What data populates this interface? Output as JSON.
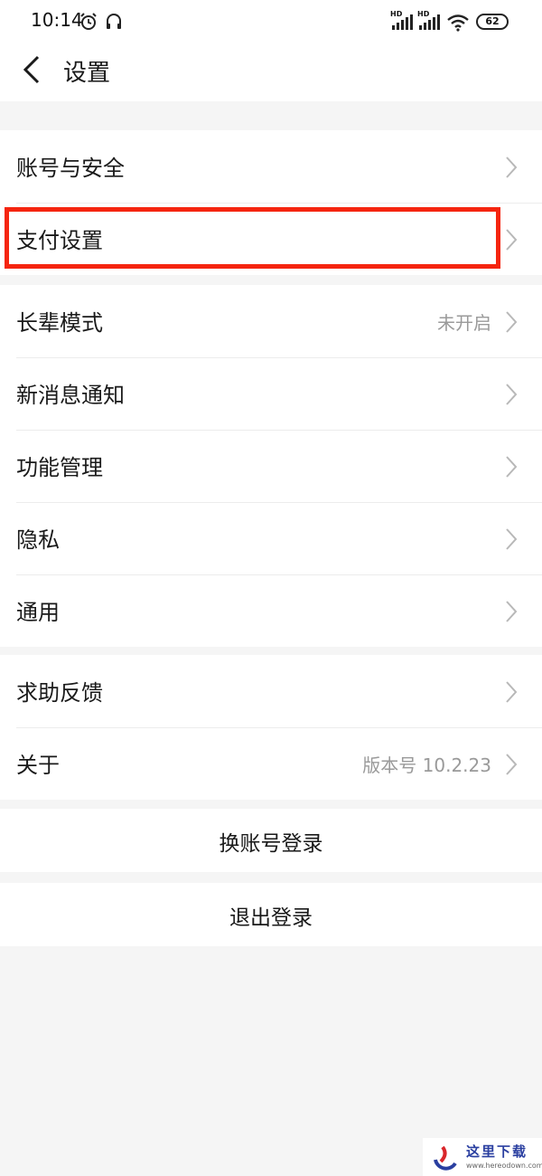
{
  "status_bar": {
    "time": "10:14",
    "signal_1_label": "HD",
    "signal_2_label": "HD",
    "battery": "62"
  },
  "header": {
    "title": "设置",
    "back_icon": "chevron-left-icon"
  },
  "groups": [
    {
      "items": [
        {
          "label": "账号与安全",
          "value": ""
        },
        {
          "label": "支付设置",
          "value": ""
        }
      ]
    },
    {
      "items": [
        {
          "label": "长辈模式",
          "value": "未开启"
        },
        {
          "label": "新消息通知",
          "value": ""
        },
        {
          "label": "功能管理",
          "value": ""
        },
        {
          "label": "隐私",
          "value": ""
        },
        {
          "label": "通用",
          "value": ""
        }
      ]
    },
    {
      "items": [
        {
          "label": "求助反馈",
          "value": ""
        },
        {
          "label": "关于",
          "value": "版本号 10.2.23"
        }
      ]
    }
  ],
  "actions": {
    "switch_account": "换账号登录",
    "logout": "退出登录"
  },
  "highlight": {
    "color": "#f5250f",
    "target": "支付设置"
  },
  "watermark": {
    "text": "这里下载",
    "url": "www.hereodown.com"
  }
}
